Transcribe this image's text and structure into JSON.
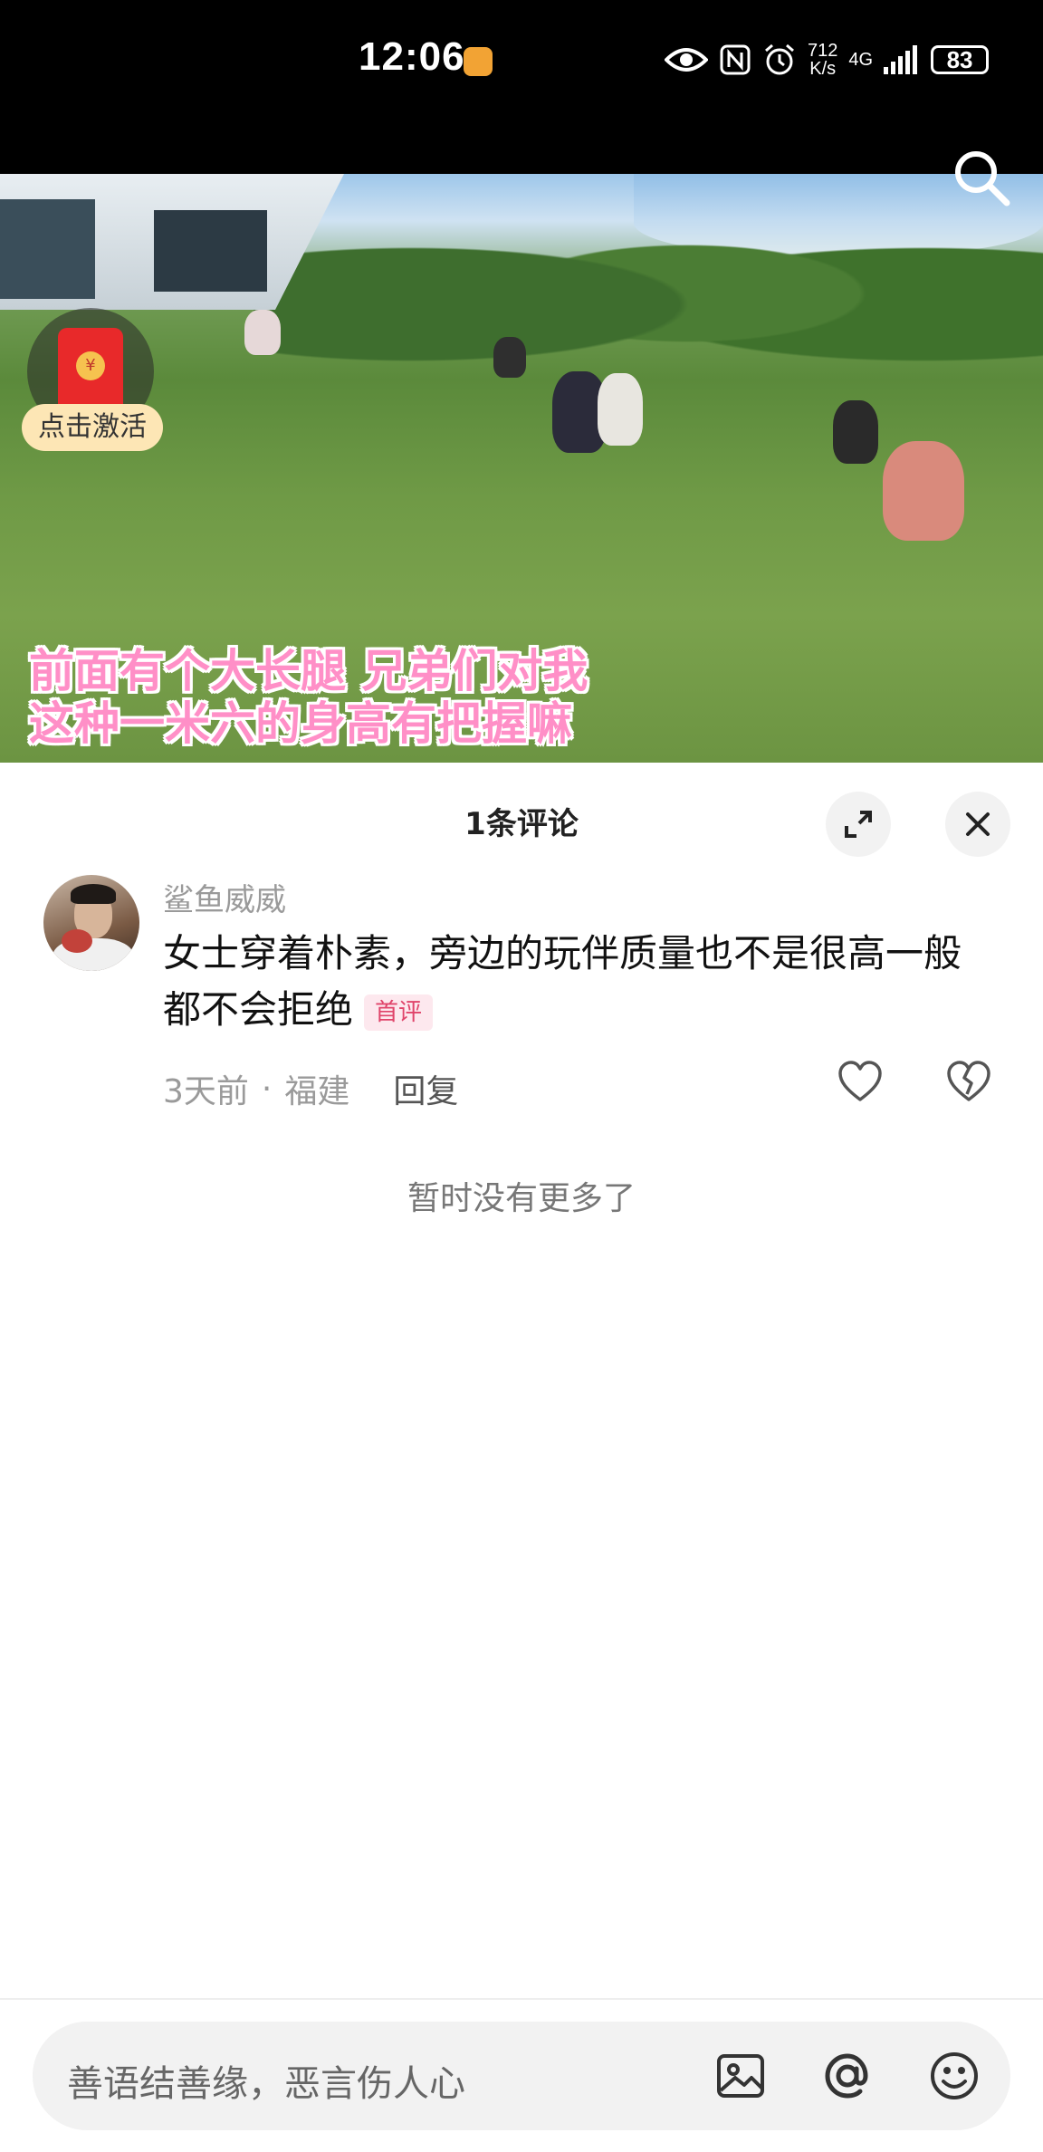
{
  "status_bar": {
    "time": "12:06",
    "net_speed_value": "712",
    "net_speed_unit": "K/s",
    "network_type": "4G",
    "battery": "83"
  },
  "video": {
    "caption_line1": "前面有个大长腿 兄弟们对我",
    "caption_line2": "这种一米六的身高有把握嘛",
    "red_packet_label": "点击激活",
    "red_packet_coin": "¥"
  },
  "comments": {
    "title": "1条评论",
    "items": [
      {
        "username": "鲨鱼威威",
        "text": "女士穿着朴素，旁边的玩伴质量也不是很高一般都不会拒绝",
        "tag": "首评",
        "time": "3天前",
        "separator": "·",
        "location": "福建",
        "reply_label": "回复"
      }
    ],
    "no_more": "暂时没有更多了"
  },
  "input": {
    "placeholder": "善语结善缘，恶言伤人心"
  },
  "colors": {
    "caption_pink": "#ff8fc7",
    "tag_red": "#e0446a",
    "packet_red": "#e8292a"
  }
}
